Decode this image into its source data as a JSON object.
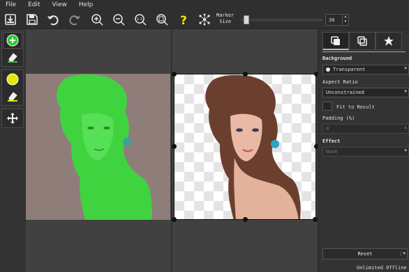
{
  "menu": [
    "File",
    "Edit",
    "View",
    "Help"
  ],
  "toolbar": {
    "icons": [
      "open-file-icon",
      "save-icon",
      "undo-icon",
      "redo-icon",
      "zoom-in-icon",
      "zoom-out-icon",
      "zoom-actual-icon",
      "zoom-fit-icon",
      "help-icon",
      "network-icon"
    ],
    "marker_label_line1": "Marker",
    "marker_label_line2": "Size",
    "marker_size": "30"
  },
  "left_tools": [
    "add-foreground-icon",
    "erase-foreground-icon",
    "background-marker-icon",
    "erase-background-icon",
    "move-icon"
  ],
  "colors": {
    "foreground_marker": "#2ecc2e",
    "background_marker": "#e6e600",
    "canvas": "#414141",
    "panel": "#333333"
  },
  "panel": {
    "tabs": [
      "layers-icon",
      "copy-icon",
      "star-icon"
    ],
    "background_label": "Background",
    "background_value": "Transparent",
    "aspect_label": "Aspect Ratio",
    "aspect_value": "Unconstrained",
    "fit_label": "Fit to Result",
    "padding_label": "Padding (%)",
    "padding_value": "0",
    "effect_label": "Effect",
    "effect_value": "None",
    "reset_label": "Reset"
  },
  "status": "Unlimited Offline"
}
